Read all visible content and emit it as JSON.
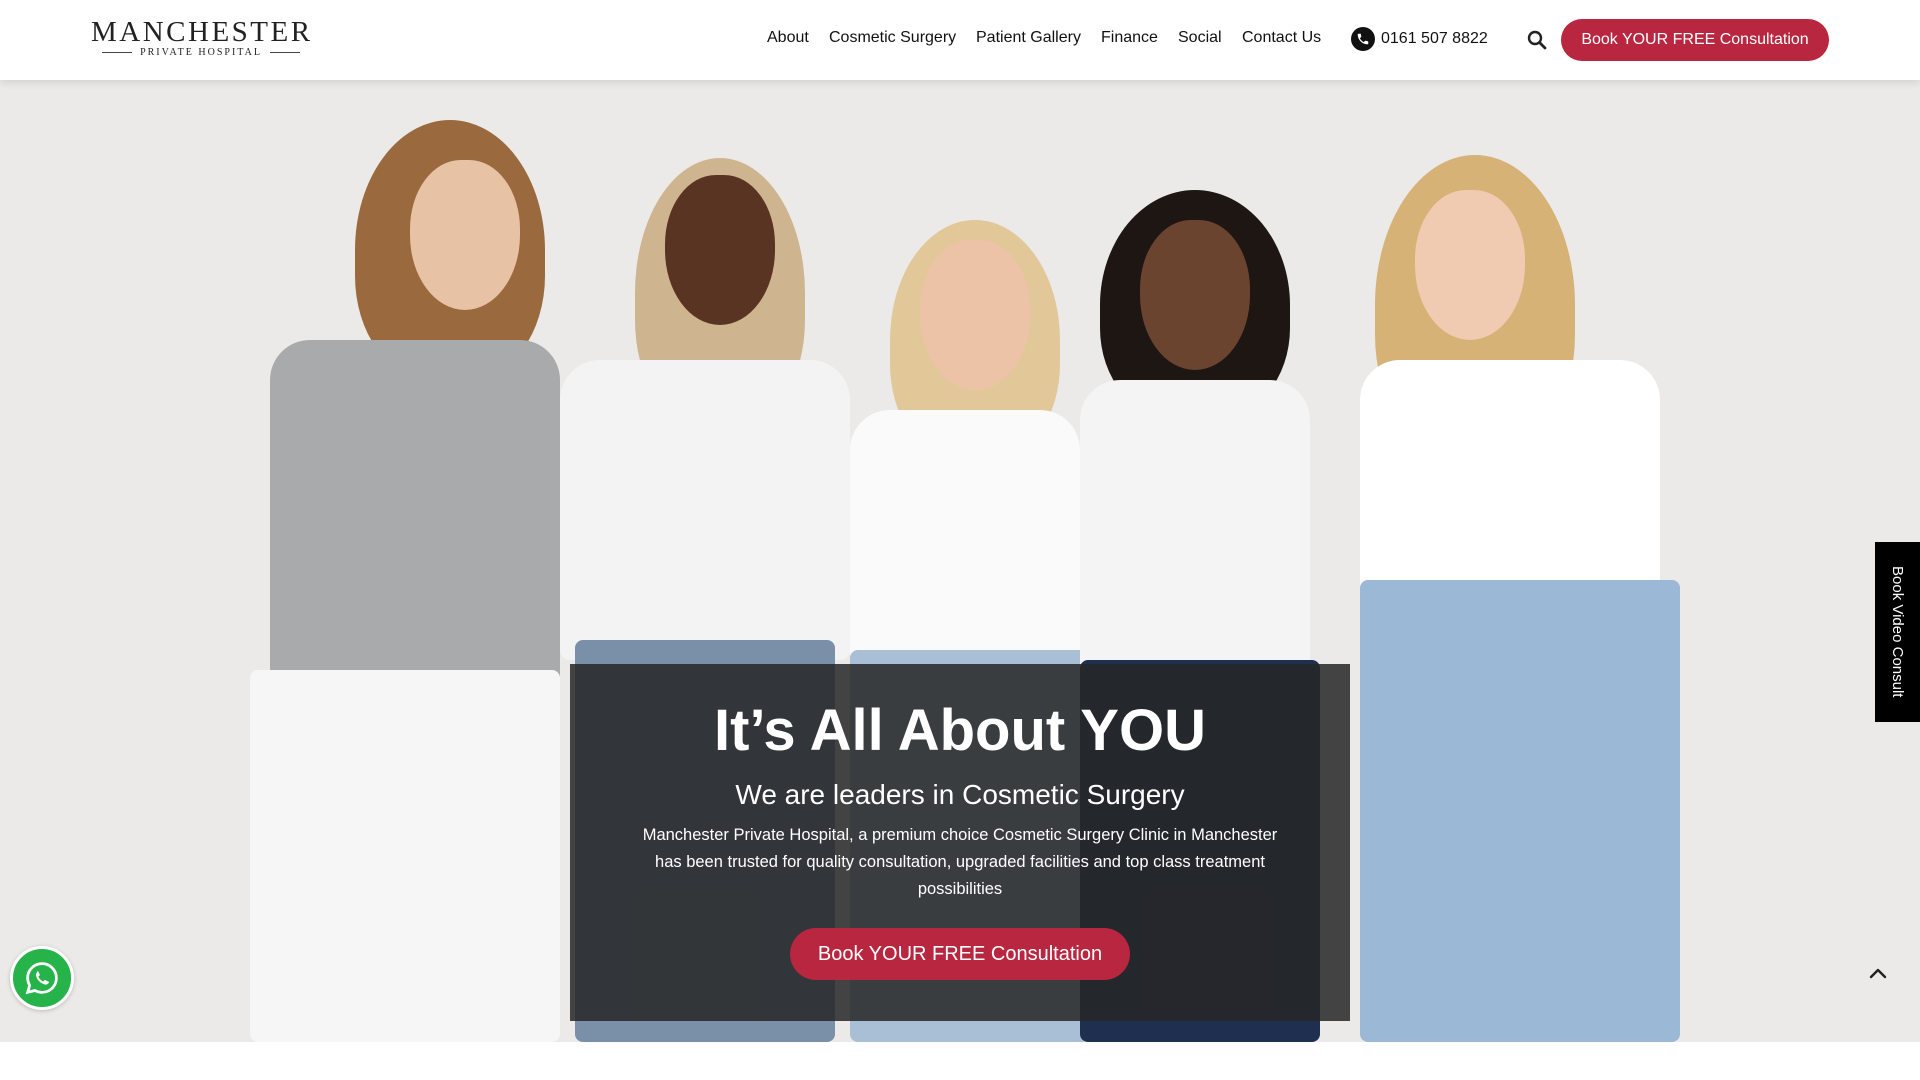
{
  "logo": {
    "main": "MANCHESTER",
    "sub": "PRIVATE HOSPITAL"
  },
  "nav": {
    "items": [
      "About",
      "Cosmetic Surgery",
      "Patient Gallery",
      "Finance",
      "Social",
      "Contact Us"
    ],
    "phone": "0161 507 8822",
    "cta": "Book YOUR FREE Consultation"
  },
  "hero": {
    "title": "It’s All About YOU",
    "subtitle": "We are leaders in Cosmetic Surgery",
    "text": "Manchester Private Hospital, a premium choice Cosmetic Surgery Clinic in Manchester has been trusted for quality consultation, upgraded facilities and top class treatment possibilities",
    "cta": "Book YOUR FREE Consultation"
  },
  "side_tab": {
    "label": "Book Video Consult"
  },
  "icons": {
    "phone": "phone-icon",
    "search": "search-icon",
    "whatsapp": "whatsapp-icon",
    "scroll_top": "chevron-up-icon"
  },
  "colors": {
    "accent": "#b8263f",
    "whatsapp": "#25b34a",
    "hero_bg": "#ebeae8"
  }
}
